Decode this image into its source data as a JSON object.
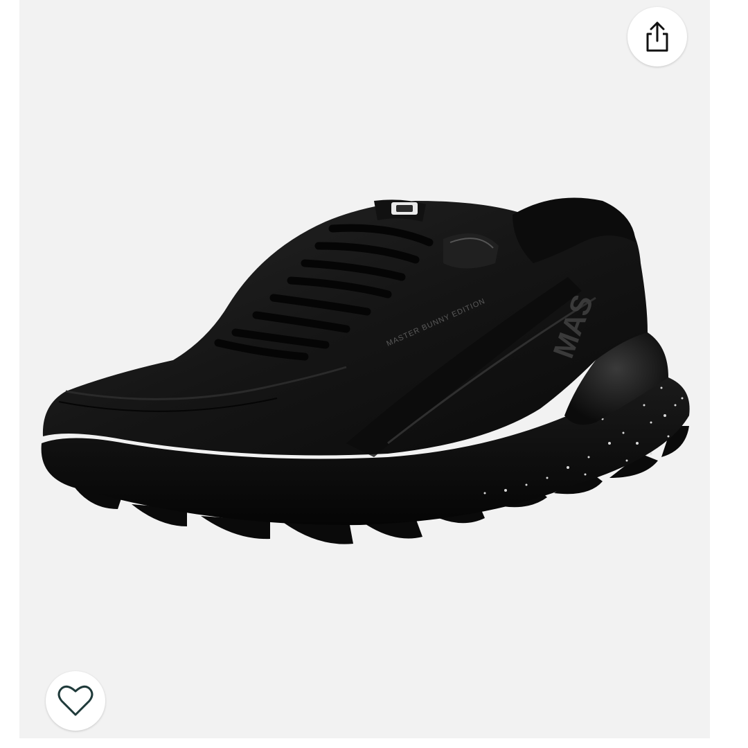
{
  "product": {
    "image_alt": "",
    "side_print": "MASTER BUNNY EDITION",
    "brand_mark": "MAS"
  },
  "actions": {
    "share_icon": "share-icon",
    "wishlist_icon": "heart-outline-icon"
  },
  "colors": {
    "background": "#f2f2f2",
    "button_bg": "#ffffff",
    "icon_share": "#111111",
    "icon_heart": "#1f3a3a"
  }
}
